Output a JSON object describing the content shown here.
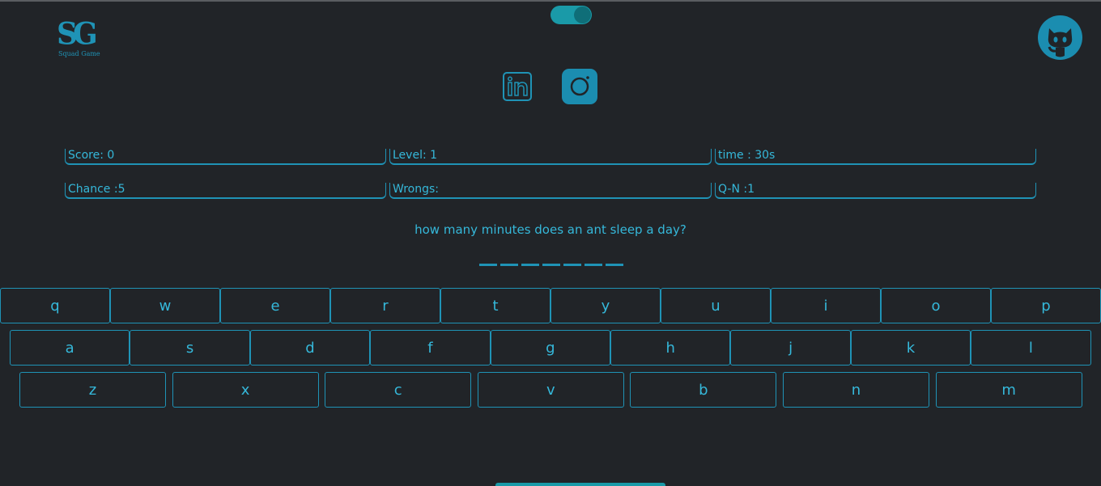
{
  "header": {
    "logo_mark": "SG",
    "logo_subtitle": "Squad Game",
    "theme_toggle": "on",
    "github_icon": "github-icon",
    "socials": [
      "linkedin-icon",
      "instagram-icon"
    ]
  },
  "stats": {
    "score": "Score: 0",
    "level": "Level: 1",
    "time": "time : 30s",
    "chance": "Chance :5",
    "wrongs": "Wrongs:",
    "qn": "Q-N :1"
  },
  "question": "how many minutes does an ant sleep a day?",
  "answer_blanks": 7,
  "keyboard": {
    "row1": [
      "q",
      "w",
      "e",
      "r",
      "t",
      "y",
      "u",
      "i",
      "o",
      "p"
    ],
    "row2": [
      "a",
      "s",
      "d",
      "f",
      "g",
      "h",
      "j",
      "k",
      "l"
    ],
    "row3": [
      "z",
      "x",
      "c",
      "v",
      "b",
      "n",
      "m"
    ]
  },
  "colors": {
    "background": "#212428",
    "accent": "#1f93b6",
    "text": "#35b8da",
    "toggle": "#1a9aa8"
  }
}
